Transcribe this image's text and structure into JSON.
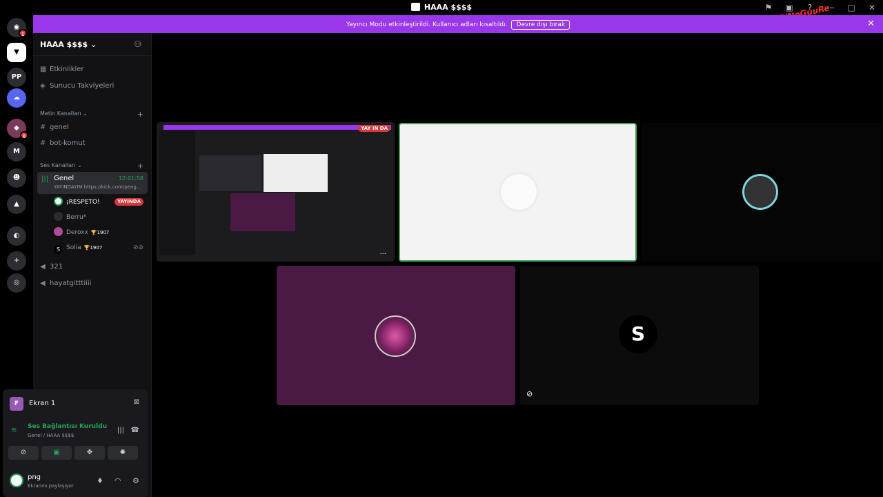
{
  "window": {
    "title": "HAAA $$$$"
  },
  "banner": {
    "message": "Yayıncı Modu etkinleştirildi. Kullanıcı adları kısaltıldı.",
    "button": "Devre dışı bırak"
  },
  "watermark": {
    "text": "BiNoGuuRe"
  },
  "rail": {
    "home_badge": "1",
    "server_badge": "6"
  },
  "server": {
    "name": "HAAA $$$$ ⌄"
  },
  "sidebar": {
    "events": "Etkinlikler",
    "boosts": "Sunucu Takviyeleri",
    "text_category": "Metin Kanalları ⌄",
    "text_channels": [
      "genel",
      "bot-komut"
    ],
    "voice_category": "Ses Kanalları ⌄",
    "active_voice": {
      "name": "Genel",
      "time": "12:01:58",
      "status": "YAYINDAYIM https://kick.com/peng..."
    },
    "members": [
      {
        "name": "¡RESPETO!",
        "live": "YAYINDA"
      },
      {
        "name": "Berru*"
      },
      {
        "name": "Deroxx",
        "trophy": "🏆1907"
      },
      {
        "name": "Solia",
        "trophy": "🏆1907"
      }
    ],
    "voice_channels": [
      "321",
      "hayatgitttiiii"
    ]
  },
  "panel": {
    "screen_label": "Ekran 1",
    "screen_initial": "F",
    "conn_title": "Ses Bağlantısı Kuruldu",
    "conn_sub": "Genel / HAAA $$$$",
    "user_name": "png",
    "user_status": "Ekranını paylaşıyor"
  },
  "stage": {
    "live_badge": "YAY IN DA",
    "dots": "...",
    "avatar_letter": "S"
  }
}
